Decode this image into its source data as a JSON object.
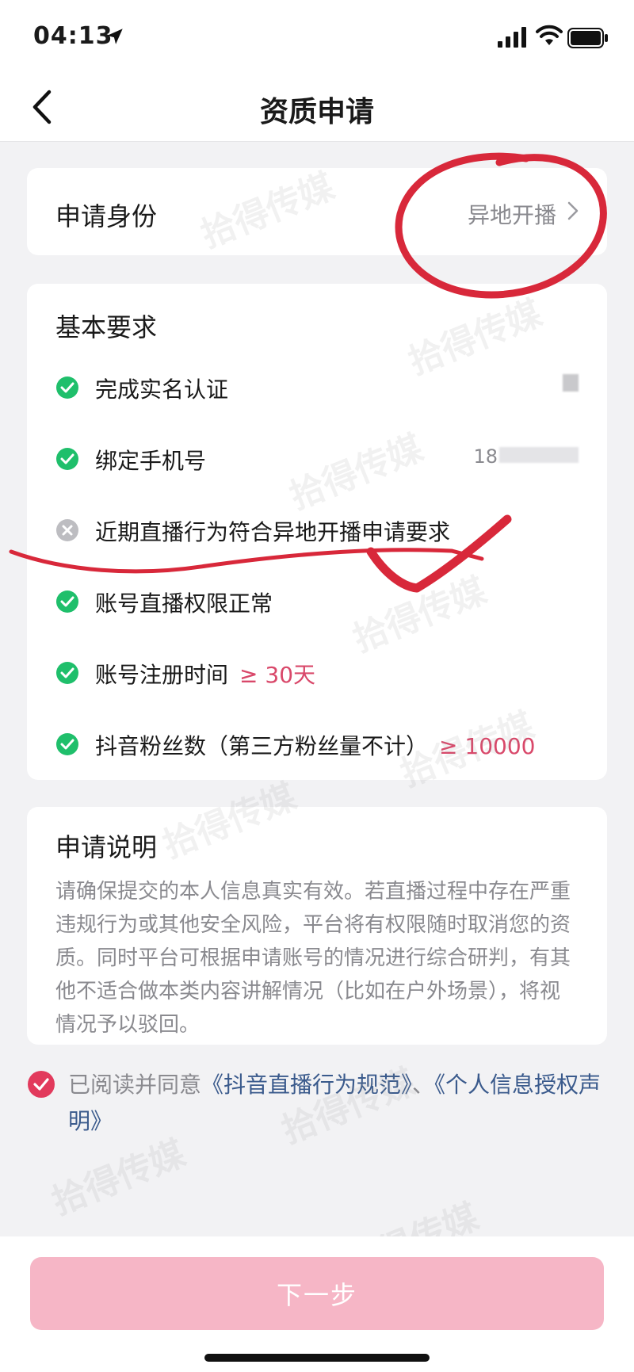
{
  "status_bar": {
    "time": "04:13"
  },
  "nav": {
    "title": "资质申请"
  },
  "identity": {
    "label": "申请身份",
    "value": "异地开播"
  },
  "requirements": {
    "title": "基本要求",
    "items": [
      {
        "text": "完成实名认证",
        "status": "done"
      },
      {
        "text": "绑定手机号",
        "status": "done",
        "side": "18"
      },
      {
        "text": "近期直播行为符合异地开播申请要求",
        "status": "failed"
      },
      {
        "text": "账号直播权限正常",
        "status": "done"
      },
      {
        "text": "账号注册时间",
        "status": "done",
        "extra": "≥ 30天"
      },
      {
        "text": "抖音粉丝数（第三方粉丝量不计）",
        "status": "done",
        "extra": "≥ 10000"
      }
    ]
  },
  "description": {
    "title": "申请说明",
    "body": "请确保提交的本人信息真实有效。若直播过程中存在严重违规行为或其他安全风险，平台将有权限随时取消您的资质。同时平台可根据申请账号的情况进行综合研判，有其他不适合做本类内容讲解情况（比如在户外场景），将视情况予以驳回。"
  },
  "agreement": {
    "prefix": "已阅读并同意",
    "link1": "《抖音直播行为规范》",
    "sep": "、",
    "link2": "《个人信息授权声明》",
    "checked": true
  },
  "footer": {
    "next_label": "下一步"
  },
  "watermark": "拾得传媒",
  "colors": {
    "accent": "#fe2c55",
    "success": "#1fbf6b",
    "highlight": "#d9486a",
    "button_disabled": "#f6b6c6",
    "annotation": "#d8283a"
  }
}
